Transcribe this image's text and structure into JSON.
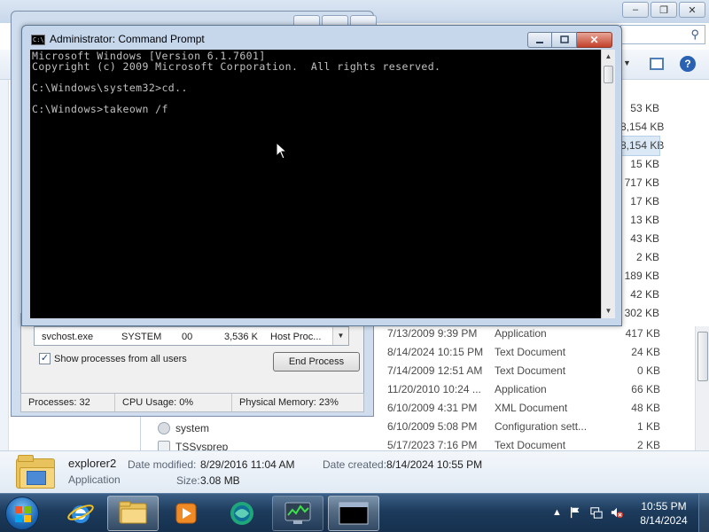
{
  "explorer": {
    "sizes": [
      "53 KB",
      "8,154 KB",
      "8,154 KB",
      "15 KB",
      "717 KB",
      "17 KB",
      "13 KB",
      "43 KB",
      "2 KB",
      "189 KB",
      "42 KB",
      "302 KB"
    ],
    "rows": [
      {
        "date": "7/13/2009 9:39 PM",
        "type": "Application",
        "size": "417 KB"
      },
      {
        "date": "8/14/2024 10:15 PM",
        "type": "Text Document",
        "size": "24 KB"
      },
      {
        "date": "7/14/2009 12:51 AM",
        "type": "Text Document",
        "size": "0 KB"
      },
      {
        "date": "11/20/2010 10:24 ...",
        "type": "Application",
        "size": "66 KB"
      },
      {
        "date": "6/10/2009 4:31 PM",
        "type": "XML Document",
        "size": "48 KB"
      },
      {
        "date": "6/10/2009 5:08 PM",
        "type": "Configuration sett...",
        "size": "1 KB"
      },
      {
        "date": "5/17/2023 7:16 PM",
        "type": "Text Document",
        "size": "2 KB"
      }
    ],
    "folder_items": [
      "system",
      "TSSysprep"
    ]
  },
  "details": {
    "name": "explorer2",
    "type": "Application",
    "modified_label": "Date modified:",
    "modified_value": "8/29/2016 11:04 AM",
    "size_label": "Size:",
    "size_value": "3.08 MB",
    "created_label": "Date created:",
    "created_value": "8/14/2024 10:55 PM"
  },
  "taskmgr": {
    "row": {
      "name": "svchost.exe",
      "user": "SYSTEM",
      "cpu": "00",
      "mem": "3,536 K",
      "desc": "Host Proc..."
    },
    "show_all_label": "Show processes from all users",
    "end_process_label": "End Process",
    "status": {
      "processes": "Processes: 32",
      "cpu": "CPU Usage: 0%",
      "memory": "Physical Memory: 23%"
    }
  },
  "cmd": {
    "icon_text": "C:\\",
    "title": "Administrator: Command Prompt",
    "lines": [
      "Microsoft Windows [Version 6.1.7601]",
      "Copyright (c) 2009 Microsoft Corporation.  All rights reserved.",
      "C:\\Windows\\system32>cd..",
      "C:\\Windows>takeown /f"
    ],
    "close_glyph": "✕"
  },
  "taskbar": {
    "apps": [
      "internet-explorer",
      "windows-explorer",
      "media-player",
      "browser",
      "task-manager",
      "command-prompt"
    ],
    "clock_time": "10:55 PM",
    "clock_date": "8/14/2024",
    "cmd_icon_text": "C:\\_"
  },
  "colors": {
    "console_bg": "#000000",
    "console_text": "#c0c0c0",
    "close_red": "#c2402a",
    "taskbar": "#1d3b5c"
  }
}
